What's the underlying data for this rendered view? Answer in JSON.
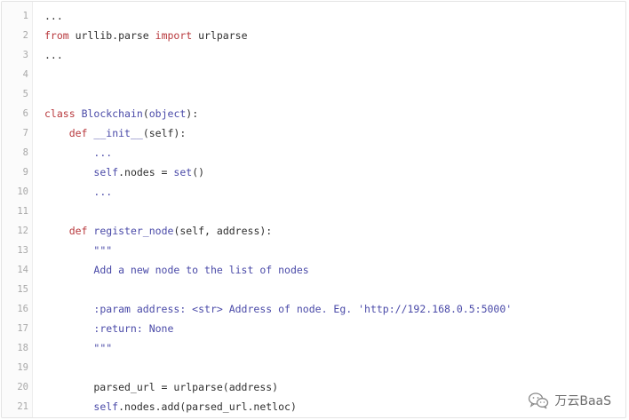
{
  "editor": {
    "lines": [
      {
        "no": "1",
        "tokens": [
          {
            "t": "...",
            "c": "tx"
          }
        ]
      },
      {
        "no": "2",
        "tokens": [
          {
            "t": "from",
            "c": "kw"
          },
          {
            "t": " urllib.parse ",
            "c": "tx"
          },
          {
            "t": "import",
            "c": "kw"
          },
          {
            "t": " urlparse",
            "c": "tx"
          }
        ]
      },
      {
        "no": "3",
        "tokens": [
          {
            "t": "...",
            "c": "tx"
          }
        ]
      },
      {
        "no": "4",
        "tokens": []
      },
      {
        "no": "5",
        "tokens": []
      },
      {
        "no": "6",
        "tokens": [
          {
            "t": "class",
            "c": "kw"
          },
          {
            "t": " ",
            "c": "tx"
          },
          {
            "t": "Blockchain",
            "c": "fn"
          },
          {
            "t": "(",
            "c": "tx"
          },
          {
            "t": "object",
            "c": "fn"
          },
          {
            "t": "):",
            "c": "tx"
          }
        ]
      },
      {
        "no": "7",
        "tokens": [
          {
            "t": "    ",
            "c": "tx"
          },
          {
            "t": "def",
            "c": "kw"
          },
          {
            "t": " ",
            "c": "tx"
          },
          {
            "t": "__init__",
            "c": "fn"
          },
          {
            "t": "(self):",
            "c": "tx"
          }
        ]
      },
      {
        "no": "8",
        "tokens": [
          {
            "t": "        ",
            "c": "tx"
          },
          {
            "t": "...",
            "c": "fn"
          }
        ]
      },
      {
        "no": "9",
        "tokens": [
          {
            "t": "        ",
            "c": "tx"
          },
          {
            "t": "self",
            "c": "fn"
          },
          {
            "t": ".nodes = ",
            "c": "tx"
          },
          {
            "t": "set",
            "c": "fn"
          },
          {
            "t": "()",
            "c": "tx"
          }
        ]
      },
      {
        "no": "10",
        "tokens": [
          {
            "t": "        ",
            "c": "tx"
          },
          {
            "t": "...",
            "c": "fn"
          }
        ]
      },
      {
        "no": "11",
        "tokens": []
      },
      {
        "no": "12",
        "tokens": [
          {
            "t": "    ",
            "c": "tx"
          },
          {
            "t": "def",
            "c": "kw"
          },
          {
            "t": " ",
            "c": "tx"
          },
          {
            "t": "register_node",
            "c": "fn"
          },
          {
            "t": "(self, address):",
            "c": "tx"
          }
        ]
      },
      {
        "no": "13",
        "tokens": [
          {
            "t": "        ",
            "c": "tx"
          },
          {
            "t": "\"\"\"",
            "c": "fn"
          }
        ]
      },
      {
        "no": "14",
        "tokens": [
          {
            "t": "        ",
            "c": "tx"
          },
          {
            "t": "Add a new node to the list of nodes",
            "c": "fn"
          }
        ]
      },
      {
        "no": "15",
        "tokens": []
      },
      {
        "no": "16",
        "tokens": [
          {
            "t": "        ",
            "c": "tx"
          },
          {
            "t": ":param address: <str> Address of node. Eg. 'http://192.168.0.5:5000'",
            "c": "fn"
          }
        ]
      },
      {
        "no": "17",
        "tokens": [
          {
            "t": "        ",
            "c": "tx"
          },
          {
            "t": ":return: None",
            "c": "fn"
          }
        ]
      },
      {
        "no": "18",
        "tokens": [
          {
            "t": "        ",
            "c": "tx"
          },
          {
            "t": "\"\"\"",
            "c": "fn"
          }
        ]
      },
      {
        "no": "19",
        "tokens": []
      },
      {
        "no": "20",
        "tokens": [
          {
            "t": "        parsed_url = urlparse(address)",
            "c": "tx"
          }
        ]
      },
      {
        "no": "21",
        "tokens": [
          {
            "t": "        ",
            "c": "tx"
          },
          {
            "t": "self",
            "c": "fn"
          },
          {
            "t": ".nodes.add(parsed_url.netloc)",
            "c": "tx"
          }
        ]
      }
    ]
  },
  "watermark": {
    "text": "万云BaaS",
    "icon": "wechat-icon"
  }
}
